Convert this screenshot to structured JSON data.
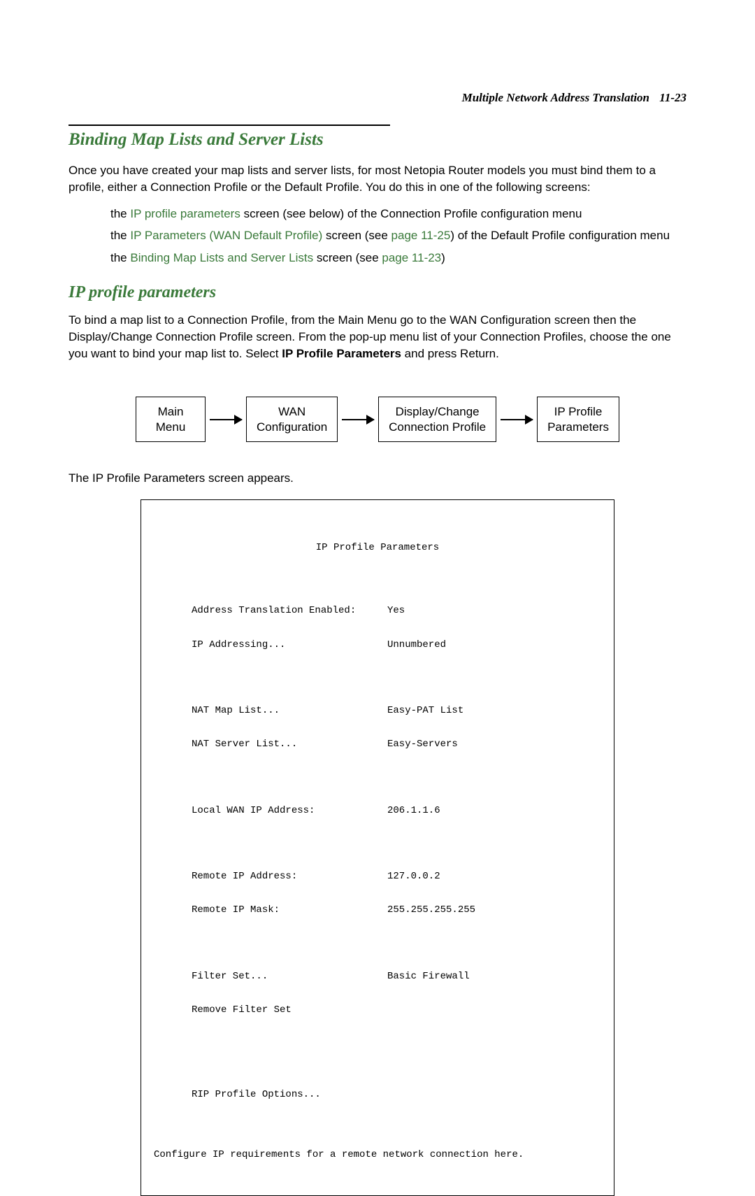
{
  "header": {
    "title": "Multiple Network Address Translation",
    "page_number": "11-23"
  },
  "section1": {
    "heading": "Binding Map Lists and Server Lists",
    "para": "Once you have created your map lists and server lists, for most Netopia Router models you must bind them to a profile, either a Connection Profile or the Default Profile. You do this in one of the following screens:",
    "bullets": [
      {
        "pre": "the ",
        "link": "IP profile parameters",
        "post": " screen (see below) of the Connection Profile configuration menu"
      },
      {
        "pre": "the ",
        "link": "IP Parameters (WAN Default Profile)",
        "mid": " screen (see ",
        "link2": "page 11-25",
        "post": ") of the Default Profile configuration menu"
      },
      {
        "pre": "the ",
        "link": "Binding Map Lists and Server Lists",
        "mid": " screen (see ",
        "link2": "page 11-23",
        "post": ")"
      }
    ]
  },
  "section2": {
    "heading": "IP profile parameters",
    "para_pre": "To bind a map list to a Connection Profile, from the Main Menu go to the WAN Configuration screen then the Display/Change Connection Profile screen. From the pop-up menu list of your Connection Profiles, choose the one you want to bind your map list to. Select ",
    "para_bold": "IP Profile Parameters",
    "para_post": " and press Return."
  },
  "flow": {
    "box1": "Main\nMenu",
    "box2": "WAN\nConfiguration",
    "box3": "Display/Change\nConnection Profile",
    "box4": "IP Profile\nParameters"
  },
  "after_flow": "The IP Profile Parameters screen appears.",
  "terminal": {
    "title": "IP Profile Parameters",
    "rows": [
      {
        "label": "Address Translation Enabled:",
        "value": "Yes"
      },
      {
        "label": "IP Addressing...",
        "value": "Unnumbered"
      }
    ],
    "rows2": [
      {
        "label": "NAT Map List...",
        "value": "Easy-PAT List"
      },
      {
        "label": "NAT Server List...",
        "value": "Easy-Servers"
      }
    ],
    "rows3": [
      {
        "label": "Local WAN IP Address:",
        "value": "206.1.1.6"
      }
    ],
    "rows4": [
      {
        "label": "Remote IP Address:",
        "value": "127.0.0.2"
      },
      {
        "label": "Remote IP Mask:",
        "value": "255.255.255.255"
      }
    ],
    "rows5": [
      {
        "label": "Filter Set...",
        "value": "Basic Firewall"
      },
      {
        "label": "Remove Filter Set",
        "value": ""
      }
    ],
    "rows6": [
      {
        "label": "RIP Profile Options...",
        "value": ""
      }
    ],
    "footer": "Configure IP requirements for a remote network connection here."
  }
}
